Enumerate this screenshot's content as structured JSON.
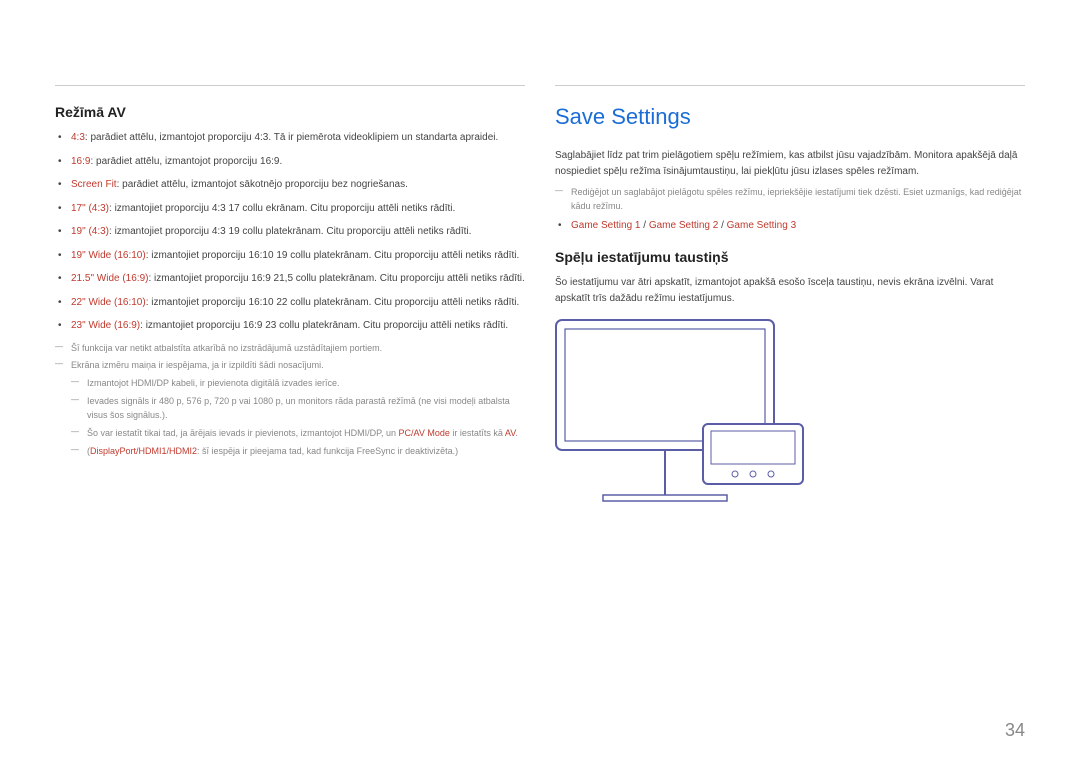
{
  "left": {
    "heading": "Režīmā AV",
    "items": [
      {
        "label": "4:3",
        "desc": ": parādiet attēlu, izmantojot proporciju 4:3. Tā ir piemērota videoklipiem un standarta apraidei."
      },
      {
        "label": "16:9",
        "desc": ": parādiet attēlu, izmantojot proporciju 16:9."
      },
      {
        "label": "Screen Fit",
        "desc": ": parādiet attēlu, izmantojot sākotnējo proporciju bez nogriešanas."
      },
      {
        "label": "17\" (4:3)",
        "desc": ": izmantojiet proporciju 4:3 17 collu ekrānam. Citu proporciju attēli netiks rādīti."
      },
      {
        "label": "19\" (4:3)",
        "desc": ": izmantojiet proporciju 4:3 19 collu platekrānam. Citu proporciju attēli netiks rādīti."
      },
      {
        "label": "19\" Wide (16:10)",
        "desc": ": izmantojiet proporciju 16:10 19 collu platekrānam. Citu proporciju attēli netiks rādīti."
      },
      {
        "label": "21.5\" Wide (16:9)",
        "desc": ": izmantojiet proporciju 16:9 21,5 collu platekrānam. Citu proporciju attēli netiks rādīti."
      },
      {
        "label": "22\" Wide (16:10)",
        "desc": ": izmantojiet proporciju 16:10 22 collu platekrānam. Citu proporciju attēli netiks rādīti."
      },
      {
        "label": "23\" Wide (16:9)",
        "desc": ": izmantojiet proporciju 16:9 23 collu platekrānam. Citu proporciju attēli netiks rādīti."
      }
    ],
    "notes": {
      "n1": "Šī funkcija var netikt atbalstīta atkarībā no izstrādājumā uzstādītajiem portiem.",
      "n2": "Ekrāna izmēru maiņa ir iespējama, ja ir izpildīti šādi nosacījumi.",
      "n2a": "Izmantojot HDMI/DP kabeli, ir pievienota digitālā izvades ierīce.",
      "n2b": "Ievades signāls ir 480 p, 576 p, 720 p vai 1080 p, un monitors rāda parastā režīmā (ne visi modeļi atbalsta visus šos signālus.).",
      "n2c_prefix": "Šo var iestatīt tikai tad, ja ārējais ievads ir pievienots, izmantojot HDMI/DP, un ",
      "n2c_red1": "PC/AV Mode",
      "n2c_mid": " ir iestatīts kā ",
      "n2c_red2": "AV",
      "n2c_end": ".",
      "n2d_prefix": "(",
      "n2d_red": "DisplayPort/HDMI1/HDMI2",
      "n2d_end": ": šī iespēja ir pieejama tad, kad funkcija FreeSync ir deaktivizēta.)"
    }
  },
  "right": {
    "title": "Save Settings",
    "p1": "Saglabājiet līdz pat trim pielāgotiem spēļu režīmiem, kas atbilst jūsu vajadzībām. Monitora apakšējā daļā nospiediet spēļu režīma īsinājumtaustiņu, lai piekļūtu jūsu izlases spēles režīmam.",
    "note1": "Rediģējot un saglabājot pielāgotu spēles režīmu, iepriekšējie iestatījumi tiek dzēsti. Esiet uzmanīgs, kad rediģējat kādu režīmu.",
    "gs1": "Game Setting 1",
    "gs2": "Game Setting 2",
    "gs3": "Game Setting 3",
    "sep": " / ",
    "sub_heading": "Spēļu iestatījumu taustiņš",
    "p2": "Šo iestatījumu var ātri apskatīt, izmantojot apakšā esošo īsceļa taustiņu, nevis ekrāna izvēlni. Varat apskatīt trīs dažādu režīmu iestatījumus."
  },
  "page_number": "34"
}
